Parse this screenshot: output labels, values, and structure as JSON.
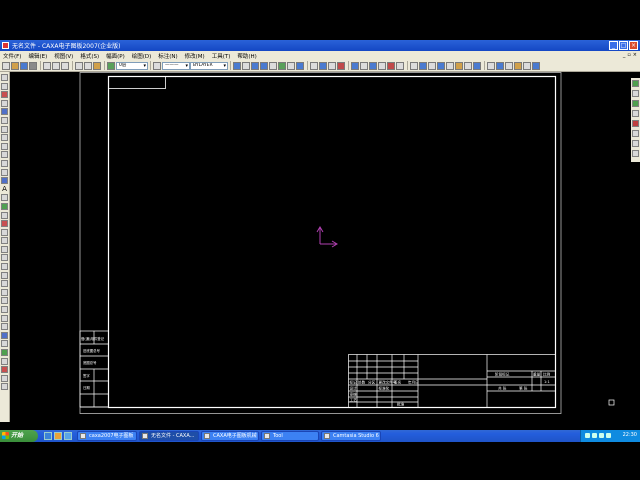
{
  "window": {
    "title": "无名文件 - CAXA电子图板2007(企业版)"
  },
  "menubar": {
    "items": [
      "文件(F)",
      "编辑(E)",
      "视图(V)",
      "格式(S)",
      "幅面(P)",
      "绘图(D)",
      "标注(N)",
      "修改(M)",
      "工具(T)",
      "帮助(H)"
    ]
  },
  "toolbar": {
    "layer_value": "0层",
    "linetype_value": "BYLAYER"
  },
  "titleblock": {
    "label_a": "标记",
    "label_b": "处数",
    "label_c": "分区",
    "label_d": "更改文件号",
    "label_e": "签名",
    "label_f": "年月日",
    "label_g": "设计",
    "label_h": "标准化",
    "label_i": "审核",
    "label_j": "工艺",
    "label_k": "批准",
    "label_stage": "阶段标记",
    "label_weight": "重量",
    "label_scale": "比例",
    "scale_value": "1:1",
    "label_sheet": "共 张",
    "label_page": "第 张"
  },
  "sidebar_block": {
    "r1": "借(通)用件登记",
    "r2": "旧底图总号",
    "r3": "底图总号",
    "r4": "签字",
    "r5": "日期"
  },
  "taskbar": {
    "start_label": "开始",
    "tasks": [
      "caxa2007电子图板",
      "无名文件 - CAXA...",
      "CAXA电子图板机械",
      "Tool",
      "Camtasia Studio 6"
    ],
    "clock": "22:30"
  }
}
